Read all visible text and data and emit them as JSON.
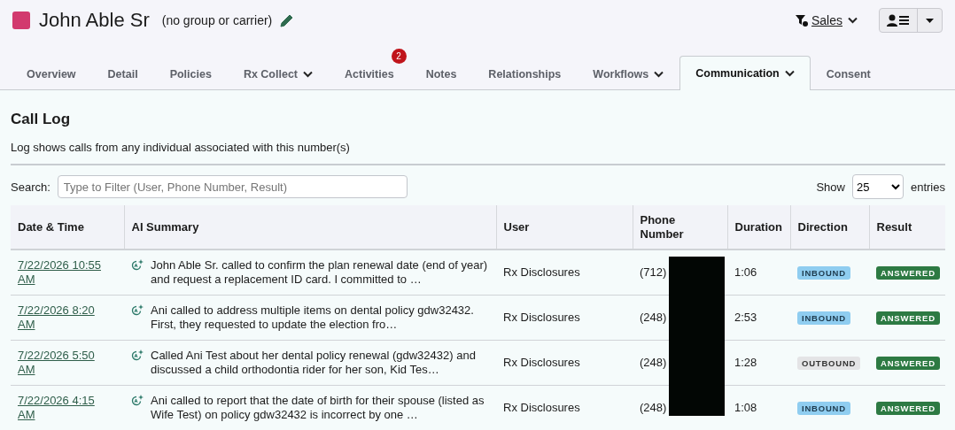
{
  "header": {
    "color": "#d23a6e",
    "name": "John Able Sr",
    "subtitle": "(no group or carrier)",
    "filter_label": "Sales"
  },
  "tabs": [
    {
      "label": "Overview",
      "selected": false,
      "dropdown": false
    },
    {
      "label": "Detail",
      "selected": false,
      "dropdown": false
    },
    {
      "label": "Policies",
      "selected": false,
      "dropdown": false
    },
    {
      "label": "Rx Collect",
      "selected": false,
      "dropdown": true
    },
    {
      "label": "Activities",
      "selected": false,
      "dropdown": false,
      "badge": "2"
    },
    {
      "label": "Notes",
      "selected": false,
      "dropdown": false
    },
    {
      "label": "Relationships",
      "selected": false,
      "dropdown": false
    },
    {
      "label": "Workflows",
      "selected": false,
      "dropdown": true
    },
    {
      "label": "Communication",
      "selected": true,
      "dropdown": true
    },
    {
      "label": "Consent",
      "selected": false,
      "dropdown": false
    }
  ],
  "call_log": {
    "title": "Call Log",
    "description": "Log shows calls from any individual associated with this number(s)",
    "search_label": "Search:",
    "search_placeholder": "Type to Filter (User, Phone Number, Result)",
    "show_label": "Show",
    "page_size": "25",
    "entries_label": "entries",
    "columns": [
      "Date & Time",
      "AI Summary",
      "User",
      "Phone Number",
      "Duration",
      "Direction",
      "Result"
    ],
    "rows": [
      {
        "date": "7/22/2026 10:55 AM",
        "summary": "John Able Sr. called to confirm the plan renewal date (end of year) and request a replacement ID card. I committed to …",
        "user": "Rx Disclosures",
        "phone": "(712)",
        "duration": "1:06",
        "direction": {
          "label": "INBOUND",
          "kind": "inbound"
        },
        "result": {
          "label": "ANSWERED",
          "kind": "answered"
        }
      },
      {
        "date": "7/22/2026 8:20 AM",
        "summary": "Ani called to address multiple items on dental policy gdw32432. First, they requested to update the election fro…",
        "user": "Rx Disclosures",
        "phone": "(248)",
        "duration": "2:53",
        "direction": {
          "label": "INBOUND",
          "kind": "inbound"
        },
        "result": {
          "label": "ANSWERED",
          "kind": "answered"
        }
      },
      {
        "date": "7/22/2026 5:50 AM",
        "summary": "Called Ani Test about her dental policy renewal (gdw32432) and discussed a child orthodontia rider for her son, Kid Tes…",
        "user": "Rx Disclosures",
        "phone": "(248)",
        "duration": "1:28",
        "direction": {
          "label": "OUTBOUND",
          "kind": "outbound"
        },
        "result": {
          "label": "ANSWERED",
          "kind": "answered"
        }
      },
      {
        "date": "7/22/2026 4:15 AM",
        "summary": "Ani called to report that the date of birth for their spouse (listed as Wife Test) on policy gdw32432 is incorrect by one …",
        "user": "Rx Disclosures",
        "phone": "(248)",
        "duration": "1:08",
        "direction": {
          "label": "INBOUND",
          "kind": "inbound"
        },
        "result": {
          "label": "ANSWERED",
          "kind": "answered"
        }
      }
    ]
  }
}
